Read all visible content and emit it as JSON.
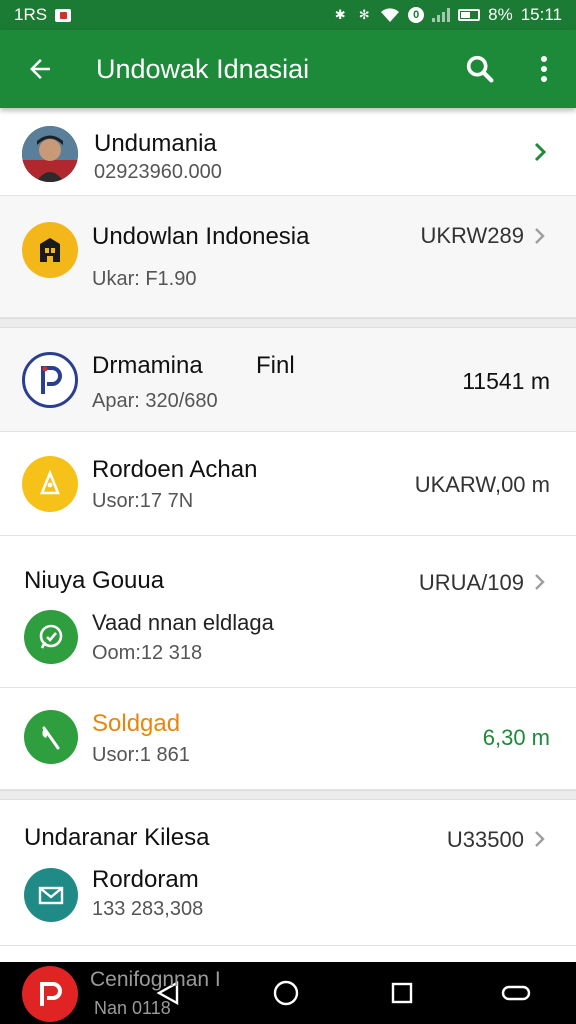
{
  "status_bar": {
    "time_left": "1RS",
    "battery": "8%",
    "clock": "15:11"
  },
  "app_bar": {
    "title": "Undowak Idnasiai",
    "icons": [
      "back-arrow-icon",
      "search-icon",
      "more-vert-icon"
    ]
  },
  "items": [
    {
      "name": "Undumania",
      "sub": "02923960.000",
      "value": "",
      "icon": "profile-photo"
    },
    {
      "name": "Undowlan Indonesia",
      "sub": "Ukar: F1.90",
      "value": "UKRW289",
      "icon": "building-icon"
    },
    {
      "name": "Drmamina",
      "name_extra": "Finl",
      "sub": "Apar: 320/680",
      "value": "11541 m",
      "icon": "p-logo-icon"
    },
    {
      "name": "Rordoen Achan",
      "sub": "Usor:17 7N",
      "value": "UKARW,00 m",
      "icon": "bell-icon"
    },
    {
      "header": "Niuya Gouua",
      "name": "Vaad nnan eldlaga",
      "sub": "Oom:12 318",
      "value": "URUA/109",
      "icon": "whatsapp-icon"
    },
    {
      "name": "Soldgad",
      "sub": "Usor:1 861",
      "value": "6,30 m",
      "icon": "leaf-icon"
    },
    {
      "header": "Undaranar Kilesa",
      "name": "Rordoram",
      "sub": "133 283,308",
      "value": "U33500",
      "icon": "mail-icon"
    }
  ],
  "ghost_item": {
    "name": "Cenifognnan I",
    "sub": "Nan 0118"
  },
  "colors": {
    "primary": "#1d8a3a",
    "status": "#1b7a33",
    "accent_orange": "#e8860c",
    "accent_green": "#1d8a3a"
  },
  "nav_icons": [
    "back-triangle-icon",
    "home-circle-icon",
    "recents-square-icon",
    "pill-icon"
  ]
}
